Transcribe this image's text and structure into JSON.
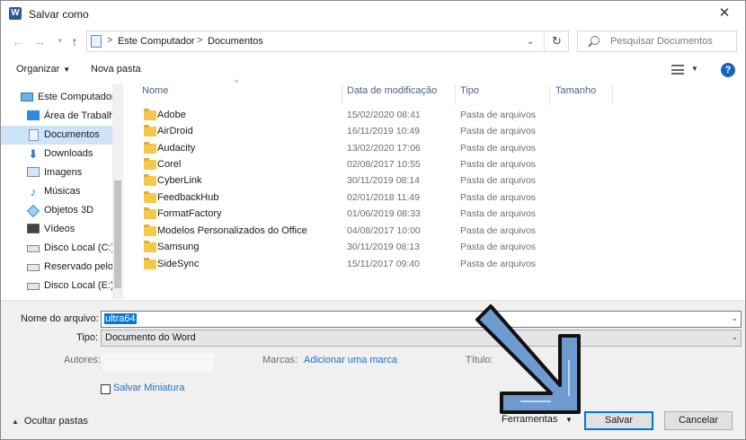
{
  "window": {
    "title": "Salvar como",
    "app_icon": "word-icon",
    "close_label": "✕"
  },
  "address": {
    "crumbs": [
      "Este Computador",
      "Documentos"
    ],
    "separator": ">",
    "search_placeholder": "Pesquisar Documentos"
  },
  "toolbar": {
    "organize_label": "Organizar",
    "new_folder_label": "Nova pasta"
  },
  "sidebar": {
    "items": [
      {
        "label": "Este Computador",
        "icon": "computer-icon"
      },
      {
        "label": "Área de Trabalho",
        "icon": "desktop-icon"
      },
      {
        "label": "Documentos",
        "icon": "documents-icon",
        "selected": true
      },
      {
        "label": "Downloads",
        "icon": "download-icon"
      },
      {
        "label": "Imagens",
        "icon": "images-icon"
      },
      {
        "label": "Músicas",
        "icon": "music-icon"
      },
      {
        "label": "Objetos 3D",
        "icon": "3d-objects-icon"
      },
      {
        "label": "Vídeos",
        "icon": "videos-icon"
      },
      {
        "label": "Disco Local (C:)",
        "icon": "drive-icon"
      },
      {
        "label": "Reservado pelo S",
        "icon": "drive-icon"
      },
      {
        "label": "Disco Local (E:)",
        "icon": "drive-icon"
      }
    ]
  },
  "columns": {
    "name": "Nome",
    "date": "Data de modificação",
    "type": "Tipo",
    "size": "Tamanho"
  },
  "files": [
    {
      "name": "Adobe",
      "date": "15/02/2020 08:41",
      "type": "Pasta de arquivos"
    },
    {
      "name": "AirDroid",
      "date": "16/11/2019 10:49",
      "type": "Pasta de arquivos"
    },
    {
      "name": "Audacity",
      "date": "13/02/2020 17:06",
      "type": "Pasta de arquivos"
    },
    {
      "name": "Corel",
      "date": "02/08/2017 10:55",
      "type": "Pasta de arquivos"
    },
    {
      "name": "CyberLink",
      "date": "30/11/2019 08:14",
      "type": "Pasta de arquivos"
    },
    {
      "name": "FeedbackHub",
      "date": "02/01/2018 11:49",
      "type": "Pasta de arquivos"
    },
    {
      "name": "FormatFactory",
      "date": "01/06/2019 08:33",
      "type": "Pasta de arquivos"
    },
    {
      "name": "Modelos Personalizados do Office",
      "date": "04/08/2017 10:00",
      "type": "Pasta de arquivos"
    },
    {
      "name": "Samsung",
      "date": "30/11/2019 08:13",
      "type": "Pasta de arquivos"
    },
    {
      "name": "SideSync",
      "date": "15/11/2017 09:40",
      "type": "Pasta de arquivos"
    }
  ],
  "form": {
    "filename_label": "Nome do arquivo:",
    "filename_value": "ultra64",
    "type_label": "Tipo:",
    "type_value": "Documento do Word",
    "authors_label": "Autores:",
    "tags_label": "Marcas:",
    "tags_link": "Adicionar uma marca",
    "title_label": "Título:",
    "thumbnail_label": "Salvar Miniatura"
  },
  "footer": {
    "hide_folders_label": "Ocultar pastas",
    "tools_label": "Ferramentas",
    "save_label": "Salvar",
    "cancel_label": "Cancelar"
  },
  "colors": {
    "accent": "#0078d7",
    "selection": "#cde3f7",
    "link": "#1f6fc0",
    "folder": "#f5c84b",
    "arrow_fill": "#6f9ad0",
    "arrow_stroke": "#111111"
  }
}
